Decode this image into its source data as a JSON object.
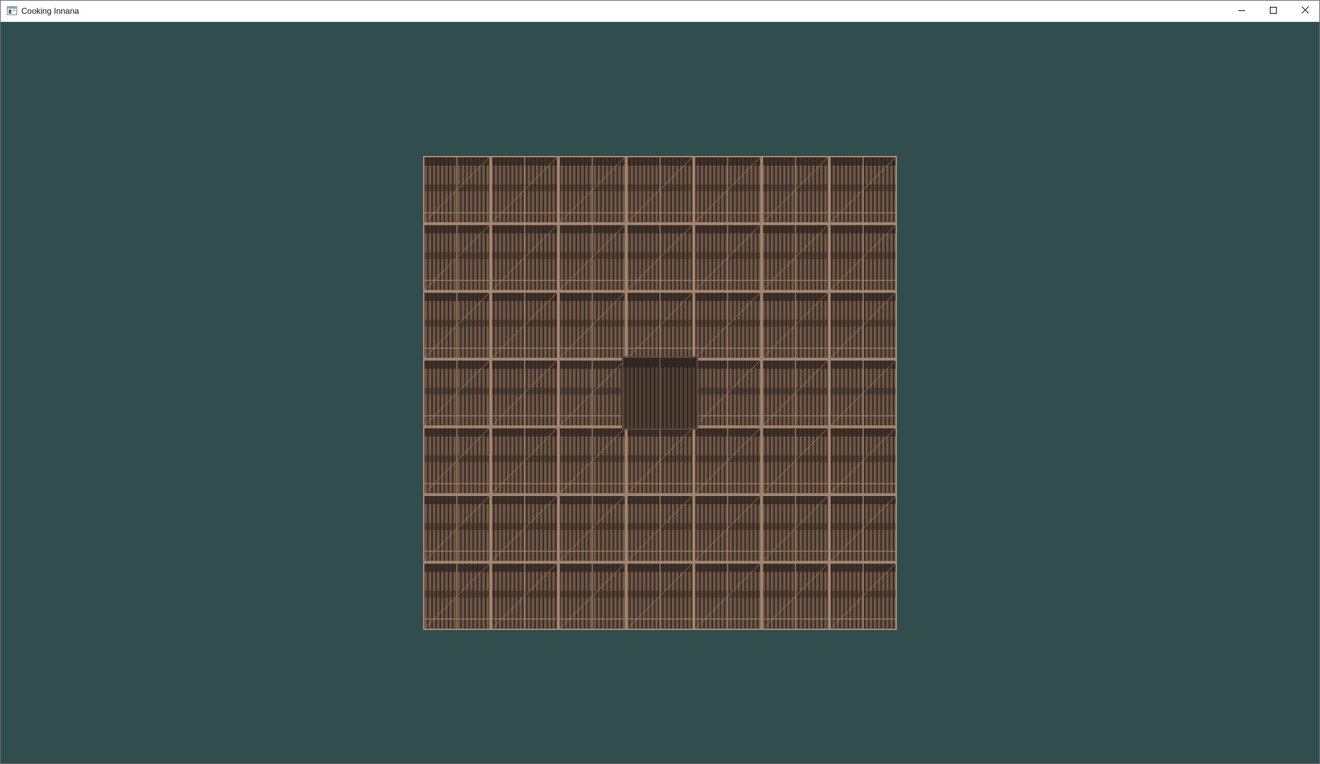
{
  "window": {
    "title": "Cooking Innana",
    "controls": {
      "minimize_icon": "minimize-icon",
      "maximize_icon": "maximize-icon",
      "close_icon": "close-icon"
    }
  },
  "scene": {
    "background_color": "#314d4e",
    "floor": {
      "texture": "wooden-plank-tile",
      "grid_columns": 7,
      "grid_rows": 7,
      "highlighted_tile": {
        "row": 3,
        "col": 3
      },
      "colors": {
        "plank_dark": "#4a3b35",
        "plank_mid": "#6b5448",
        "plank_light": "#7d6353",
        "frame": "#a98a72",
        "band": "#2f2622"
      }
    }
  }
}
